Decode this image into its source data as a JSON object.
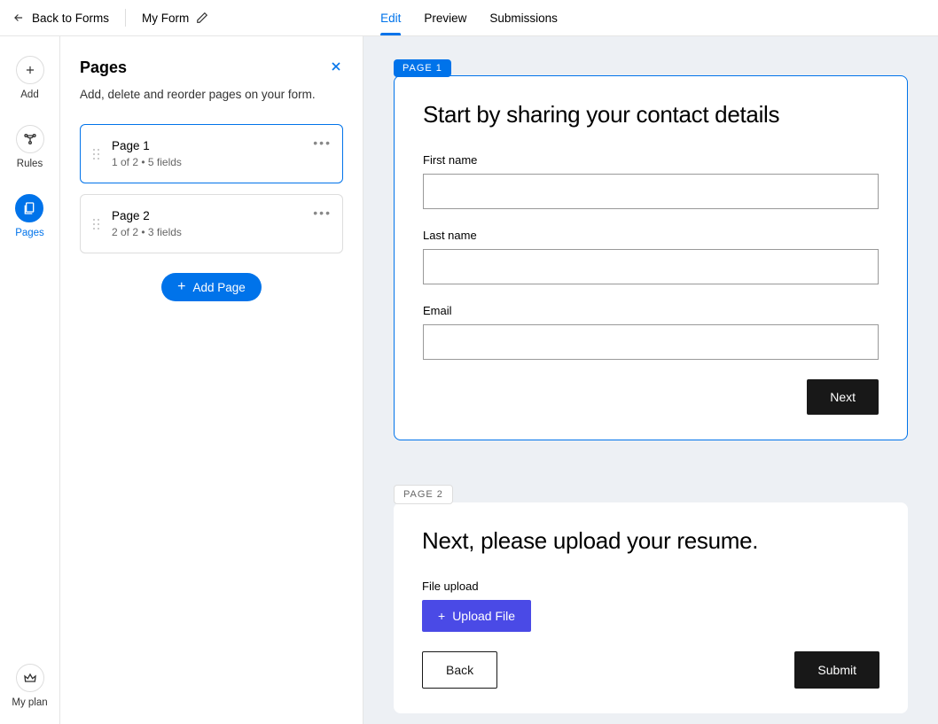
{
  "header": {
    "back": "Back to Forms",
    "formName": "My Form",
    "tabs": {
      "edit": "Edit",
      "preview": "Preview",
      "submissions": "Submissions"
    }
  },
  "rail": {
    "add": "Add",
    "rules": "Rules",
    "pages": "Pages",
    "myplan": "My plan"
  },
  "panel": {
    "title": "Pages",
    "subtitle": "Add, delete and reorder pages on your form.",
    "addPage": "Add Page",
    "items": [
      {
        "name": "Page 1",
        "meta": "1 of 2  •  5 fields"
      },
      {
        "name": "Page 2",
        "meta": "2 of 2  •  3 fields"
      }
    ]
  },
  "canvas": {
    "page1": {
      "badge": "PAGE 1",
      "title": "Start by sharing your contact details",
      "fields": {
        "first": "First name",
        "last": "Last name",
        "email": "Email"
      },
      "next": "Next"
    },
    "page2": {
      "badge": "PAGE 2",
      "title": "Next, please upload your resume.",
      "fileLabel": "File upload",
      "uploadBtn": "Upload File",
      "back": "Back",
      "submit": "Submit"
    }
  }
}
